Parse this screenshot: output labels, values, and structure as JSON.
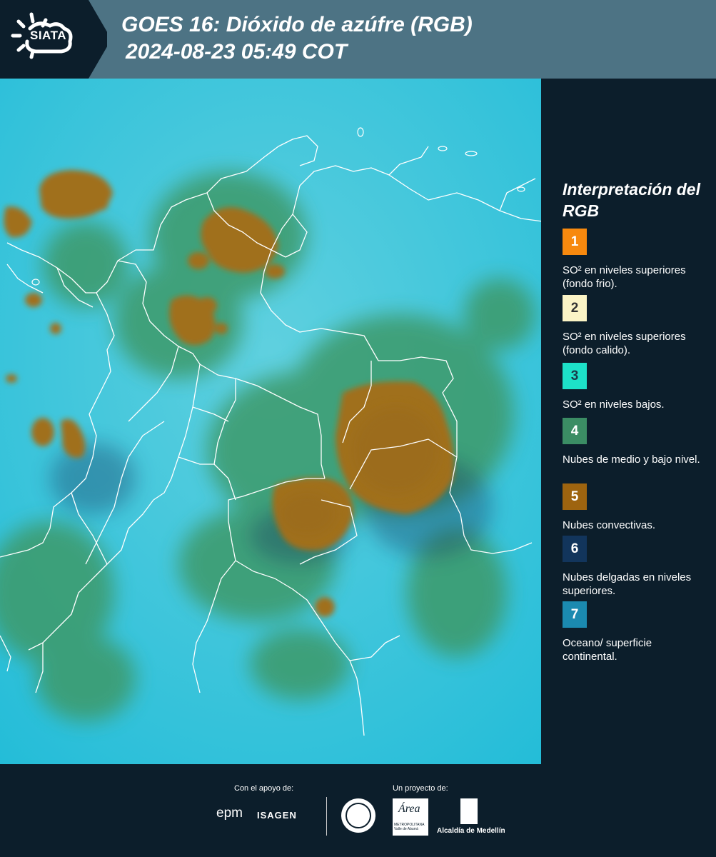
{
  "header": {
    "logo_text": "SIATA",
    "title": "GOES 16: Dióxido de azúfre (RGB)",
    "subtitle": "2024-08-23 05:49 COT"
  },
  "legend": {
    "title": "Interpretación del RGB",
    "items": [
      {
        "number": "1",
        "color": "#f7890e",
        "text_color": "#ffffff",
        "label": "SO² en niveles superiores (fondo frio)."
      },
      {
        "number": "2",
        "color": "#fbf4c6",
        "text_color": "#333333",
        "label": "SO² en niveles superiores (fondo calido)."
      },
      {
        "number": "3",
        "color": "#1de1c8",
        "text_color": "#1a3a4a",
        "label": "SO² en niveles bajos."
      },
      {
        "number": "4",
        "color": "#3b8d64",
        "text_color": "#ffffff",
        "label": "Nubes de medio y bajo nivel."
      },
      {
        "number": "5",
        "color": "#9e640f",
        "text_color": "#ffffff",
        "label": "Nubes convectivas."
      },
      {
        "number": "6",
        "color": "#12355c",
        "text_color": "#ffffff",
        "label": "Nubes delgadas en niveles superiores."
      },
      {
        "number": "7",
        "color": "#1b8ab0",
        "text_color": "#ffffff",
        "label": "Oceano/ superficie continental."
      }
    ]
  },
  "footer": {
    "support_label": "Con el apoyo de:",
    "project_label": "Un proyecto de:",
    "epm": "epm",
    "isagen": "ISAGEN",
    "area_logo": "Área",
    "area_sub": "METROPOLITANA Valle de Aburrá",
    "alcaldia": "Alcaldía de Medellín"
  },
  "colors": {
    "background": "#0c1e2b",
    "header": "#4d7384",
    "map_base": "#2bc0d8",
    "convective": "#a0701c",
    "mid_level": "#3e9a6a"
  }
}
